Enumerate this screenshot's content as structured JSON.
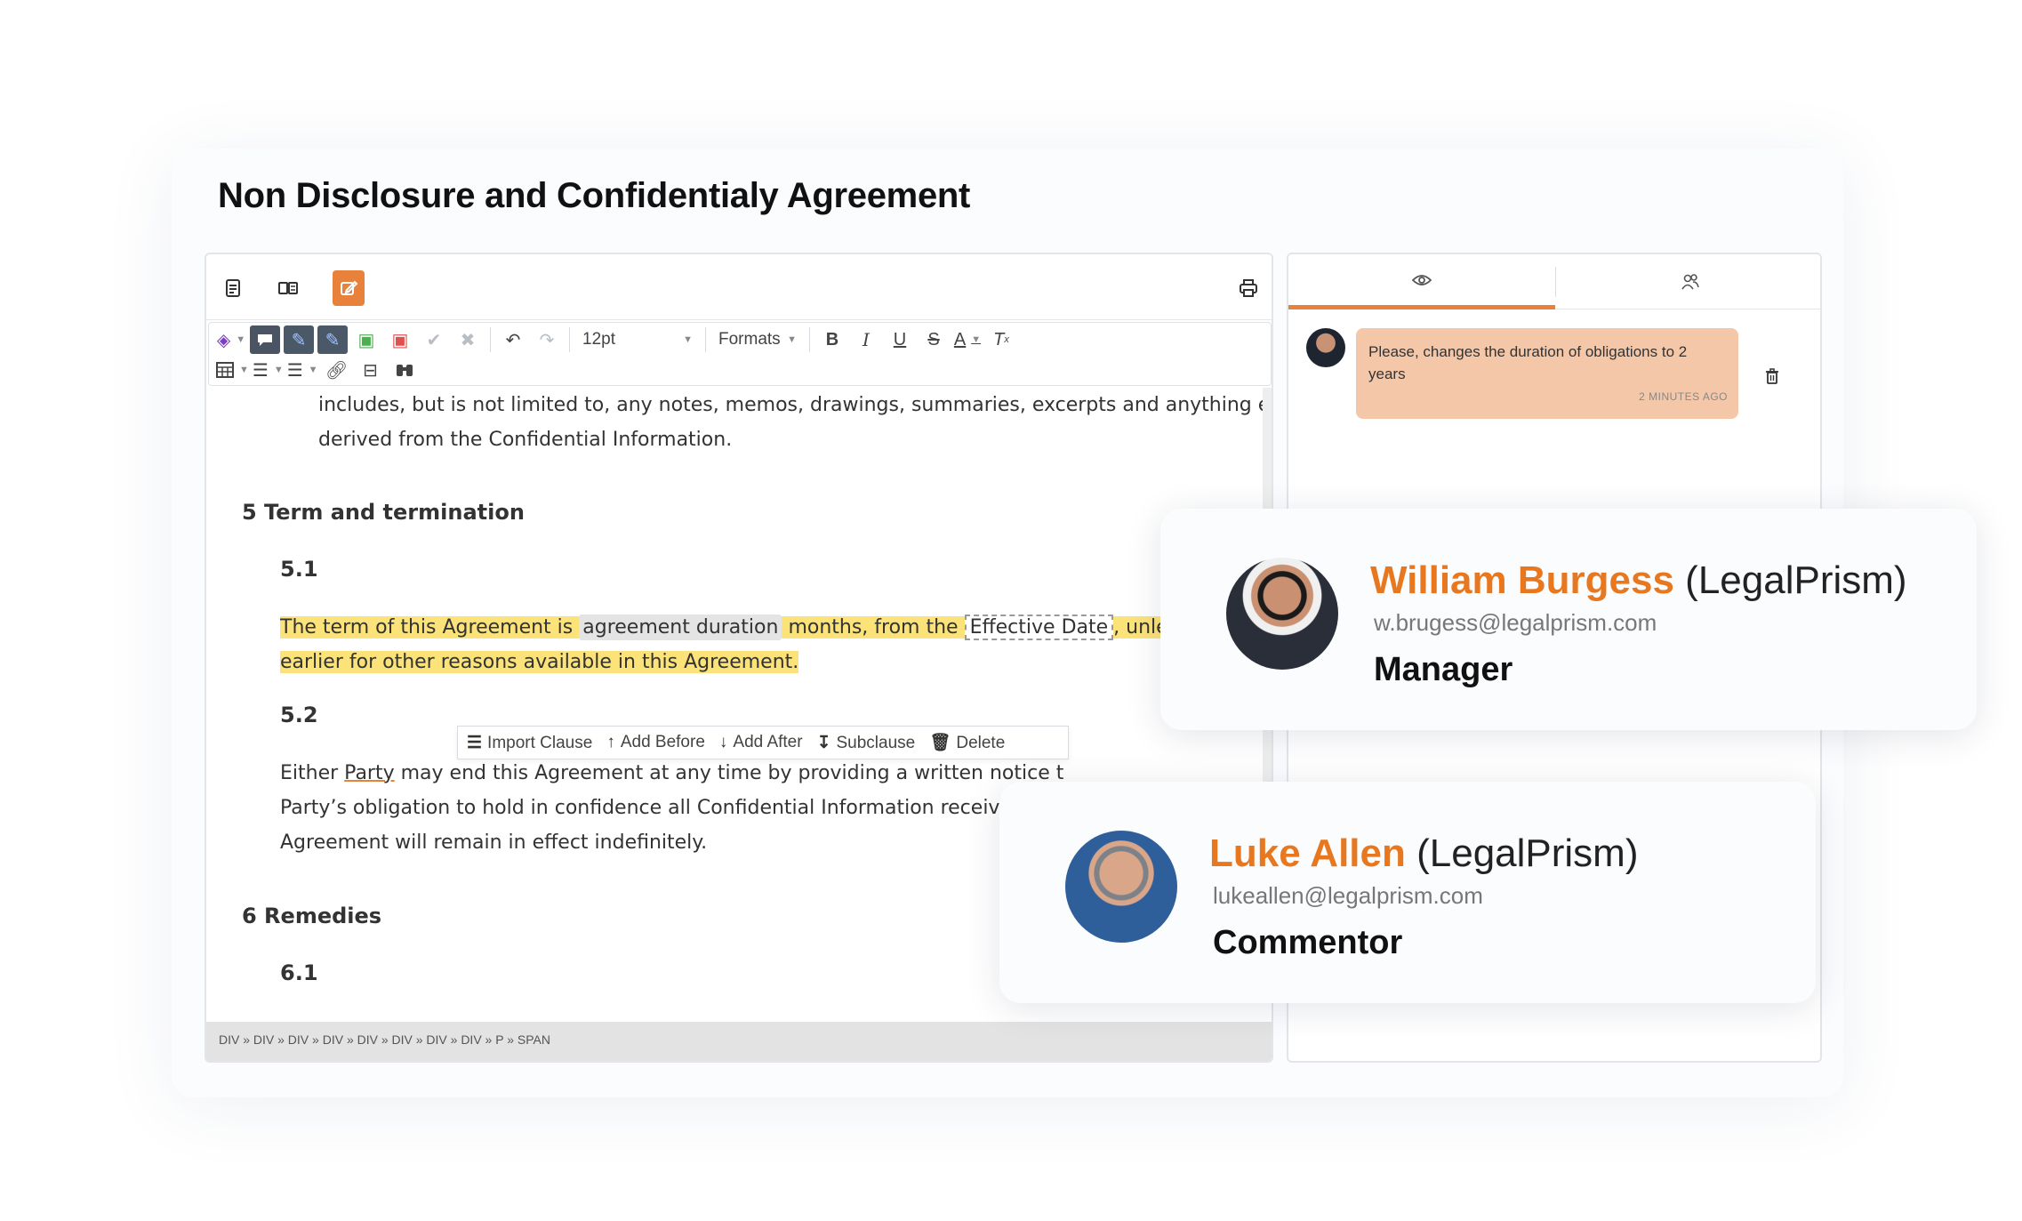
{
  "document": {
    "title": "Non Disclosure and Confidentialy Agreement"
  },
  "toolbar": {
    "font_size": "12pt",
    "formats_label": "Formats"
  },
  "content": {
    "para_prev_line1": "includes, but is not limited to, any notes, memos, drawings, summaries, excerpts and anything else",
    "para_prev_line2": "derived from the Confidential Information.",
    "section5_heading": "5 Term and termination",
    "clause_5_1": "5.1",
    "c51_text_a": "The term of this Agreement is",
    "c51_chip": "agreement duration",
    "c51_text_b": "months, from the",
    "c51_dash": "Effective Date",
    "c51_text_c": ", unless ter",
    "c51_line2": "earlier for other reasons available in this Agreement.",
    "clause_5_2": "5.2",
    "c52_line1_a": "Either",
    "c52_party": "Party",
    "c52_line1_b": "may end this Agreement at any time by providing a written notice t",
    "c52_line2": "Party’s obligation to hold in confidence all Confidential Information received d",
    "c52_line3": "Agreement will remain in effect indefinitely.",
    "section6_heading": "6 Remedies",
    "clause_6_1": "6.1"
  },
  "context_menu": {
    "import_clause": "Import Clause",
    "add_before": "Add Before",
    "add_after": "Add After",
    "subclause": "Subclause",
    "delete": "Delete"
  },
  "statusbar": {
    "path": "DIV » DIV » DIV » DIV » DIV » DIV » DIV » DIV » P » SPAN"
  },
  "comments": [
    {
      "text": "Please, changes the duration of obligations to 2 years",
      "time": "2 MINUTES AGO"
    }
  ],
  "users": [
    {
      "name": "William Burgess",
      "org": "(LegalPrism)",
      "email": "w.brugess@legalprism.com",
      "role": "Manager"
    },
    {
      "name": "Luke Allen",
      "org": "(LegalPrism)",
      "email": "lukeallen@legalprism.com",
      "role": "Commentor"
    }
  ],
  "colors": {
    "accent": "#e8823a",
    "highlight": "#fbe37a",
    "comment_bubble": "#f4c7a8"
  }
}
